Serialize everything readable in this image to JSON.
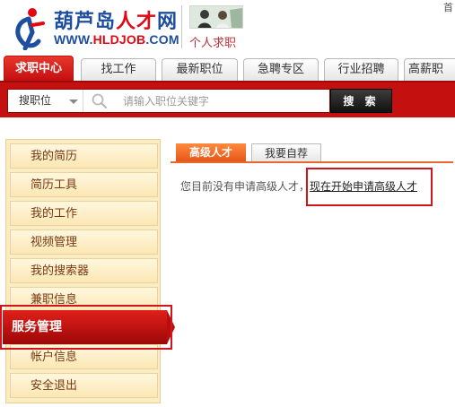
{
  "header": {
    "logo_cn_part1": "葫芦岛",
    "logo_cn_part2": "人才",
    "logo_cn_part3": "网",
    "logo_url_part1": "WWW.",
    "logo_url_part2": "HLDJOB",
    "logo_url_part3": ".COM",
    "page_label": "个人求职",
    "top_right_glyph": "首"
  },
  "tabs": [
    {
      "label": "求职中心",
      "active": true
    },
    {
      "label": "找工作",
      "active": false
    },
    {
      "label": "最新职位",
      "active": false
    },
    {
      "label": "急聘专区",
      "active": false
    },
    {
      "label": "行业招聘",
      "active": false
    },
    {
      "label": "高薪职",
      "active": false
    }
  ],
  "search": {
    "type_value": "搜职位",
    "placeholder": "请输入职位关键字",
    "button_label": "搜 索"
  },
  "sidebar": {
    "items": [
      {
        "label": "我的简历"
      },
      {
        "label": "简历工具"
      },
      {
        "label": "我的工作"
      },
      {
        "label": "视频管理"
      },
      {
        "label": "我的搜索器"
      },
      {
        "label": "兼职信息"
      },
      {
        "label": "服务管理",
        "active": true
      },
      {
        "label": "帐户信息"
      },
      {
        "label": "安全退出"
      }
    ]
  },
  "content": {
    "tabs": [
      {
        "label": "高级人才",
        "active": true
      },
      {
        "label": "我要自荐",
        "active": false
      }
    ],
    "info_text": "您目前没有申请高级人才，",
    "info_link": "现在开始申请高级人才"
  },
  "colors": {
    "brand_red": "#c4100f",
    "brand_blue": "#1d4f9e",
    "accent_orange": "#e6561a",
    "highlight_red": "#d2141d"
  }
}
